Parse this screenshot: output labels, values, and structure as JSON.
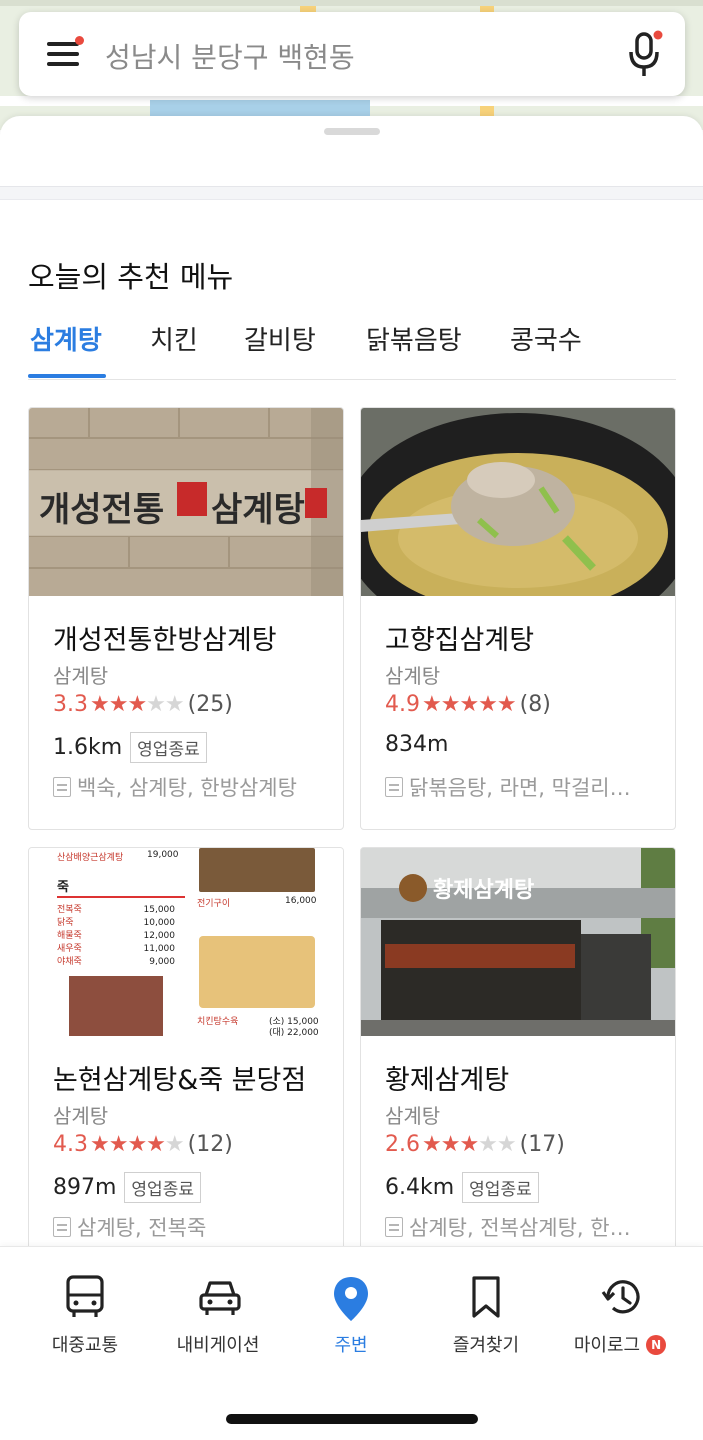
{
  "search": {
    "text": "성남시 분당구 백현동"
  },
  "section": {
    "title": "오늘의 추천 메뉴"
  },
  "tabs": [
    {
      "label": "삼계탕",
      "active": true
    },
    {
      "label": "치킨",
      "active": false
    },
    {
      "label": "갈비탕",
      "active": false
    },
    {
      "label": "닭볶음탕",
      "active": false
    },
    {
      "label": "콩국수",
      "active": false
    }
  ],
  "cards": [
    {
      "name": "개성전통한방삼계탕",
      "category": "삼계탕",
      "score": "3.3",
      "stars": 3.3,
      "count": "(25)",
      "distance": "1.6km",
      "badge": "영업종료",
      "menu": "백숙, 삼계탕, 한방삼계탕",
      "sign_text": "개성전통",
      "sign_text2": "삼계탕"
    },
    {
      "name": "고향집삼계탕",
      "category": "삼계탕",
      "score": "4.9",
      "stars": 4.9,
      "count": "(8)",
      "distance": "834m",
      "badge": "",
      "menu": "닭볶음탕, 라면, 막걸리…"
    },
    {
      "name": "논현삼계탕&죽 분당점",
      "category": "삼계탕",
      "score": "4.3",
      "stars": 4.3,
      "count": "(12)",
      "distance": "897m",
      "badge": "영업종료",
      "menu": "삼계탕, 전복죽",
      "menu_board": {
        "top_item": "산삼배양근삼계탕",
        "top_price": "19,000",
        "heading": "죽",
        "items": [
          [
            "전복죽",
            "15,000"
          ],
          [
            "닭죽",
            "10,000"
          ],
          [
            "해물죽",
            "12,000"
          ],
          [
            "새우죽",
            "11,000"
          ],
          [
            "야채죽",
            "9,000"
          ]
        ],
        "grill": "전기구이",
        "grill_price": "16,000",
        "suyuk": "치킨탕수육",
        "suyuk_small": "(소) 15,000",
        "suyuk_large": "(대) 22,000"
      }
    },
    {
      "name": "황제삼계탕",
      "category": "삼계탕",
      "score": "2.6",
      "stars": 2.6,
      "count": "(17)",
      "distance": "6.4km",
      "badge": "영업종료",
      "menu": "삼계탕, 전복삼계탕, 한…",
      "sign_text": "황제삼계탕"
    }
  ],
  "bottom_nav": [
    {
      "label": "대중교통",
      "icon": "bus-icon",
      "active": false
    },
    {
      "label": "내비게이션",
      "icon": "car-icon",
      "active": false
    },
    {
      "label": "주변",
      "icon": "location-pin-icon",
      "active": true
    },
    {
      "label": "즐겨찾기",
      "icon": "bookmark-icon",
      "active": false
    },
    {
      "label": "마이로그",
      "icon": "history-icon",
      "active": false,
      "badge": "N"
    }
  ],
  "colors": {
    "accent": "#2b7de1",
    "rating": "#e25a4e",
    "notify": "#e94a3e"
  }
}
